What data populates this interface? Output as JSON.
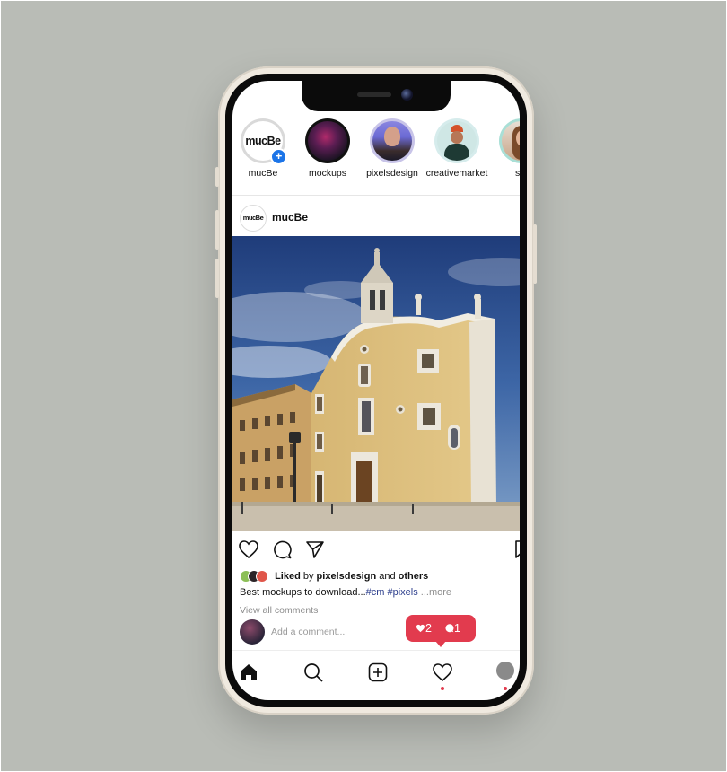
{
  "stories": [
    {
      "name": "mucBe",
      "logo": "mucBe",
      "is_own": true
    },
    {
      "name": "mockups"
    },
    {
      "name": "pixelsdesign"
    },
    {
      "name": "creativemarket"
    },
    {
      "name": "stu"
    }
  ],
  "post": {
    "author": "mucBe",
    "author_logo": "mucBe",
    "liked_word": "Liked",
    "liked_by_word": "by",
    "liked_by": "pixelsdesign",
    "liked_and": "and",
    "liked_others": "others",
    "caption_text": "Best mockups to download...",
    "caption_tags": "#cm #pixels",
    "caption_more": "...more",
    "view_comments": "View all comments",
    "add_comment_placeholder": "Add a comment..."
  },
  "notification": {
    "likes": "2",
    "comments": "1"
  },
  "colors": {
    "accent": "#e23b4e",
    "link": "#1b74e8",
    "background": "#b9bcb6"
  },
  "icons": {
    "actions": [
      "heart-icon",
      "comment-icon",
      "share-icon",
      "bookmark-icon"
    ],
    "tabbar": [
      "home-icon",
      "search-icon",
      "add-post-icon",
      "activity-icon",
      "profile-icon"
    ]
  }
}
